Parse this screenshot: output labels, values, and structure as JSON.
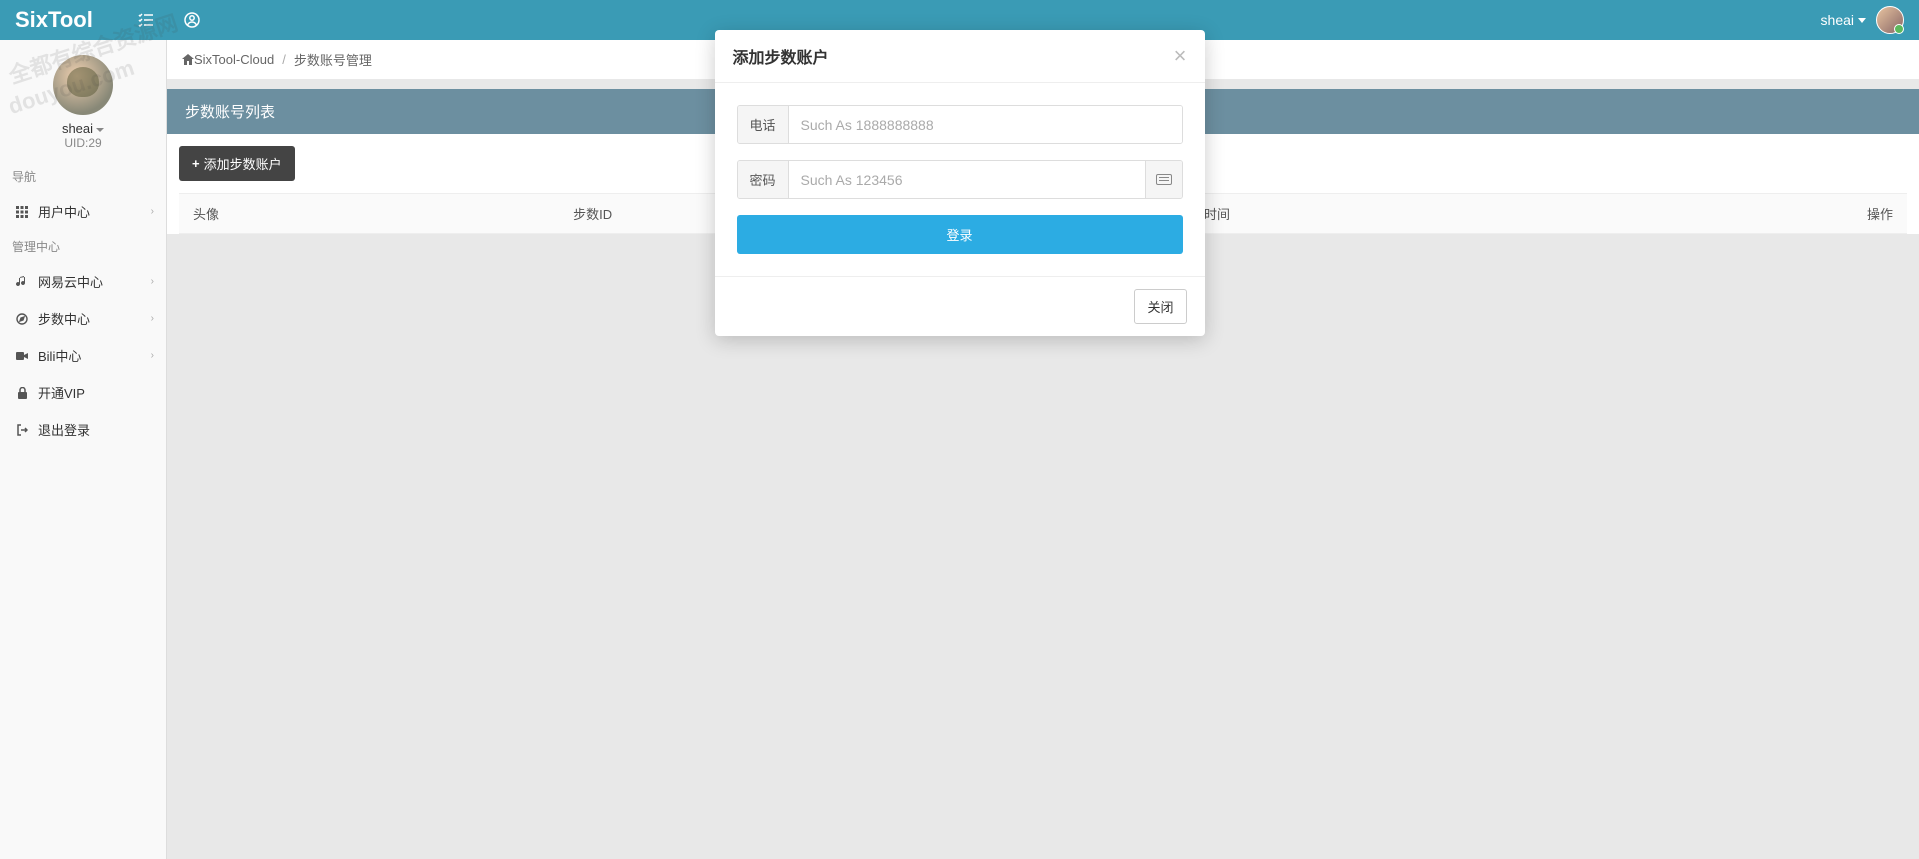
{
  "header": {
    "brand": "SixTool",
    "username": "sheai"
  },
  "profile": {
    "name": "sheai",
    "uid": "UID:29"
  },
  "watermark": {
    "line1": "全都有综合资源网",
    "line2": "douyou.com"
  },
  "sidebar": {
    "section1": "导航",
    "section2": "管理中心",
    "items": {
      "user_center": "用户中心",
      "netease": "网易云中心",
      "steps": "步数中心",
      "bili": "Bili中心",
      "vip": "开通VIP",
      "logout": "退出登录"
    }
  },
  "breadcrumb": {
    "home": "SixTool-Cloud",
    "current": "步数账号管理"
  },
  "panel": {
    "title": "步数账号列表",
    "add_btn": "添加步数账户"
  },
  "table": {
    "cols": {
      "avatar": "头像",
      "step_id": "步数ID",
      "add_time": "添加时间",
      "action": "操作"
    }
  },
  "modal": {
    "title": "添加步数账户",
    "phone_label": "电话",
    "phone_placeholder": "Such As 1888888888",
    "pwd_label": "密码",
    "pwd_placeholder": "Such As 123456",
    "login_btn": "登录",
    "close_btn": "关闭"
  }
}
